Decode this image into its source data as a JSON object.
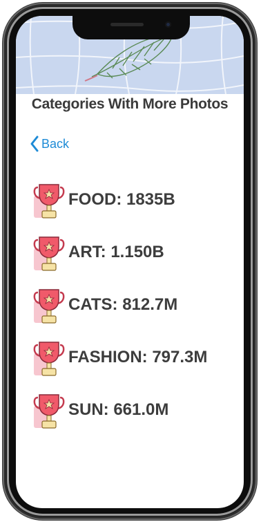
{
  "screen": {
    "title": "Categories With More Photos",
    "back_label": "Back"
  },
  "categories": [
    {
      "label": "FOOD: 1835B"
    },
    {
      "label": "ART: 1.150B"
    },
    {
      "label": "CATS: 812.7M"
    },
    {
      "label": "FASHION: 797.3M"
    },
    {
      "label": "SUN: 661.0M"
    }
  ],
  "icons": {
    "back": "chevron-left-icon",
    "category": "trophy-icon",
    "banner": "feather-icon"
  },
  "colors": {
    "banner_background": "#c9d7ef",
    "back_link": "#1e8bd6",
    "title_text": "#3a3a3a",
    "trophy_red": "#f05a6a",
    "trophy_gold": "#f6e3a6",
    "trophy_shadow": "#f7c6cf"
  }
}
